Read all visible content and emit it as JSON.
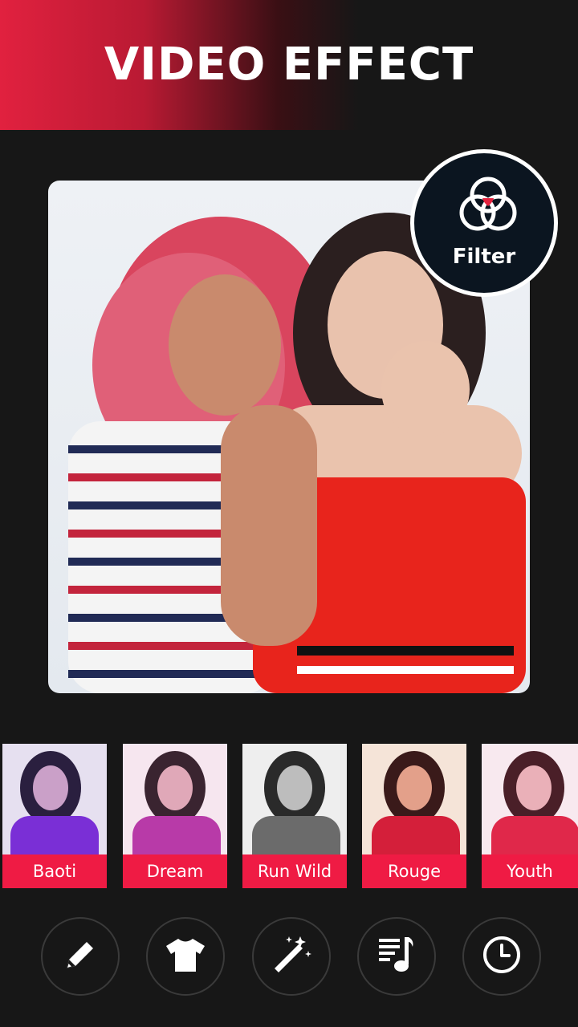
{
  "header": {
    "title": "VIDEO EFFECT"
  },
  "badge": {
    "label": "Filter",
    "icon": "filter-rings-icon"
  },
  "filters": [
    {
      "label": "Baoti",
      "tint": "#7a2fd6"
    },
    {
      "label": "Dream",
      "tint": "#b83aa8"
    },
    {
      "label": "Run Wild",
      "tint": "#6b6b6b"
    },
    {
      "label": "Rouge",
      "tint": "#d41f3a"
    },
    {
      "label": "Youth",
      "tint": "#e0284a"
    }
  ],
  "toolbar": [
    {
      "icon": "pencil-icon"
    },
    {
      "icon": "tshirt-icon"
    },
    {
      "icon": "magic-wand-icon"
    },
    {
      "icon": "music-playlist-icon"
    },
    {
      "icon": "clock-icon"
    }
  ],
  "colors": {
    "accent": "#ef1b44",
    "background": "#171717",
    "badge_bg": "#0b1520"
  }
}
